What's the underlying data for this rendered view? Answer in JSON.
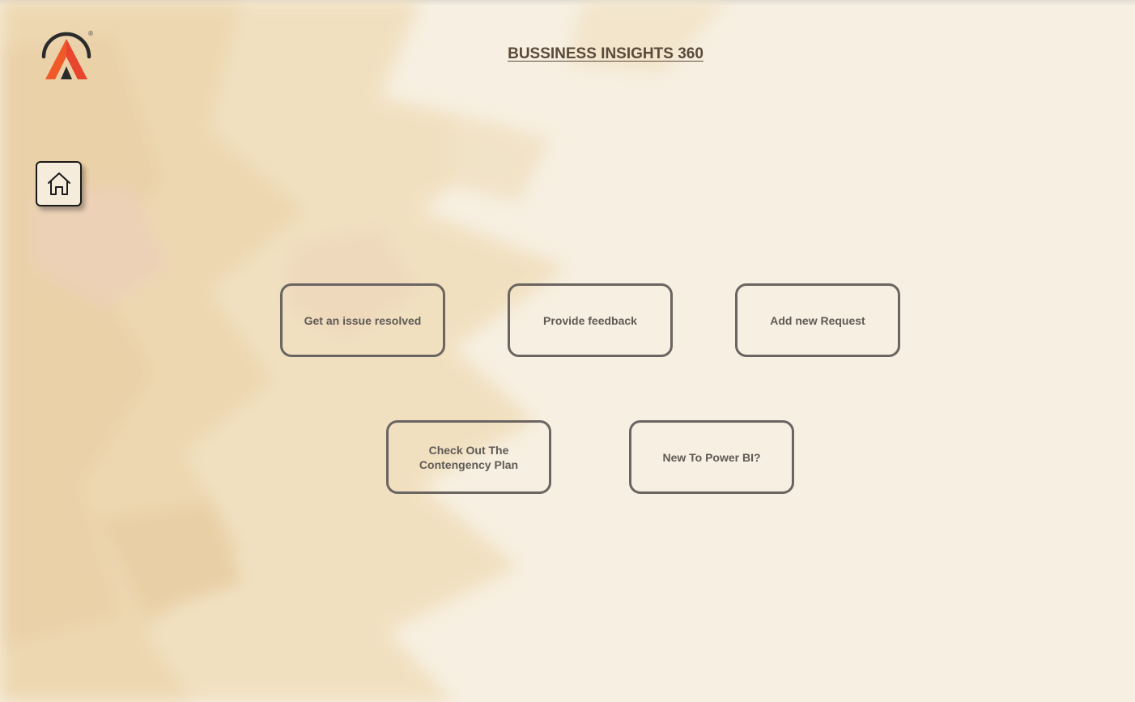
{
  "header": {
    "title": "BUSSINESS INSIGHTS 360"
  },
  "logo": {
    "icon": "company-logo-icon",
    "registered_mark": "®"
  },
  "home": {
    "icon": "home-icon"
  },
  "buttons": {
    "issue": "Get an issue resolved",
    "feedback": "Provide feedback",
    "request": "Add new Request",
    "contingency": "Check Out The Contengency Plan",
    "powerbi": "New To Power BI?"
  },
  "colors": {
    "background": "#f7efe1",
    "title": "#5a4a3a",
    "button_border": "#6b6561",
    "button_text": "#5f5a56",
    "logo_orange": "#f05a28",
    "logo_dark": "#2b2b2b"
  }
}
